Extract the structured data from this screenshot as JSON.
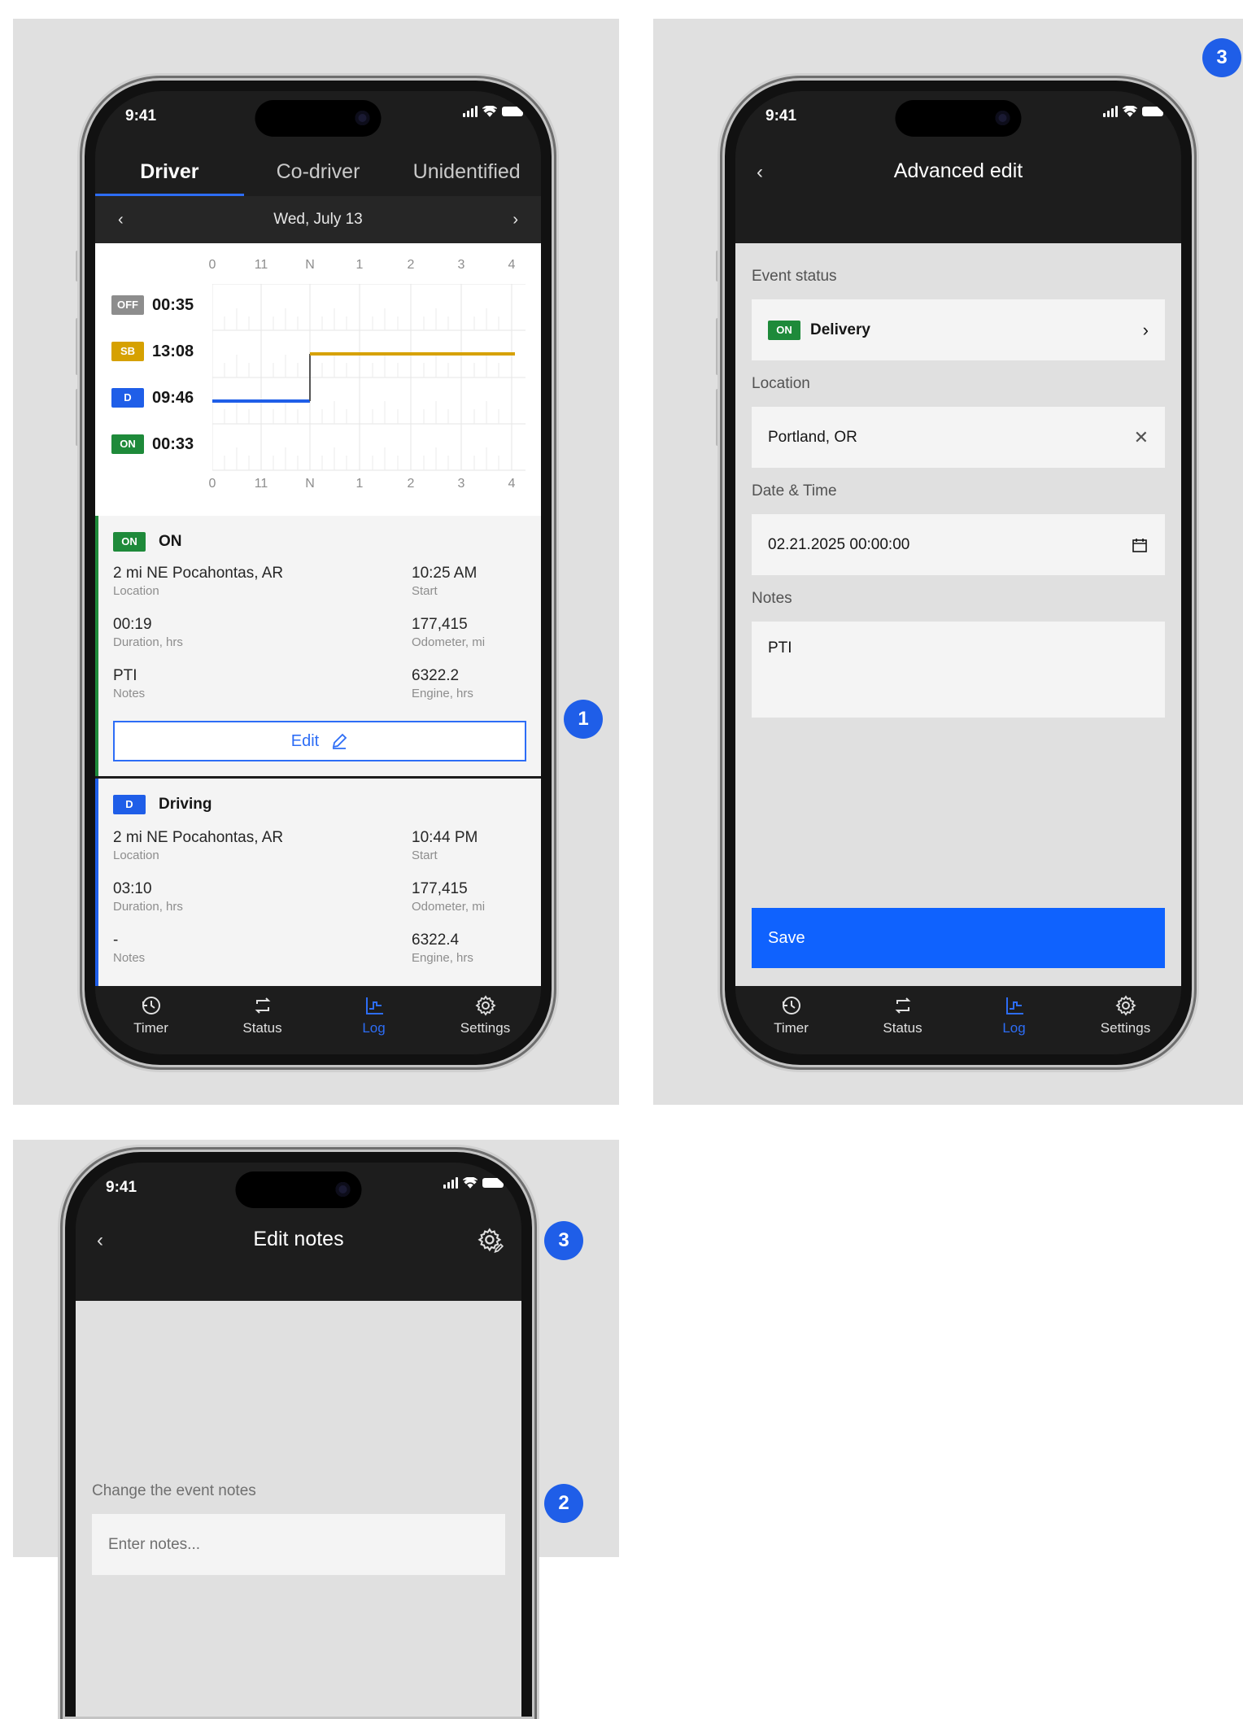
{
  "status_bar": {
    "time": "9:41"
  },
  "screen1": {
    "tabs": [
      "Driver",
      "Co-driver",
      "Unidentified"
    ],
    "date": "Wed, July 13",
    "axis_labels": [
      "0",
      "11",
      "N",
      "1",
      "2",
      "3",
      "4"
    ],
    "statuses": [
      {
        "code": "OFF",
        "time": "00:35"
      },
      {
        "code": "SB",
        "time": "13:08"
      },
      {
        "code": "D",
        "time": "09:46"
      },
      {
        "code": "ON",
        "time": "00:33"
      }
    ],
    "events": [
      {
        "badge": "ON",
        "title": "ON",
        "location": "2 mi NE Pocahontas, AR",
        "location_label": "Location",
        "start": "10:25 AM",
        "start_label": "Start",
        "duration": "00:19",
        "duration_label": "Duration, hrs",
        "odometer": "177,415",
        "odometer_label": "Odometer, mi",
        "notes": "PTI",
        "notes_label": "Notes",
        "engine": "6322.2",
        "engine_label": "Engine, hrs",
        "edit_label": "Edit"
      },
      {
        "badge": "D",
        "title": "Driving",
        "location": "2 mi NE Pocahontas, AR",
        "location_label": "Location",
        "start": "10:44 PM",
        "start_label": "Start",
        "duration": "03:10",
        "duration_label": "Duration, hrs",
        "odometer": "177,415",
        "odometer_label": "Odometer, mi",
        "notes": "-",
        "notes_label": "Notes",
        "engine": "6322.4",
        "engine_label": "Engine, hrs"
      }
    ]
  },
  "bottom_nav": [
    "Timer",
    "Status",
    "Log",
    "Settings"
  ],
  "screen2": {
    "title": "Advanced edit",
    "event_status_label": "Event status",
    "event_status_badge": "ON",
    "event_status_value": "Delivery",
    "location_label": "Location",
    "location_value": "Portland, OR",
    "datetime_label": "Date & Time",
    "datetime_value": "02.21.2025 00:00:00",
    "notes_label": "Notes",
    "notes_value": "PTI",
    "save_label": "Save"
  },
  "screen3": {
    "title": "Edit notes",
    "prompt": "Change the event notes",
    "placeholder": "Enter notes..."
  },
  "markers": [
    "1",
    "3",
    "3",
    "2"
  ],
  "colors": {
    "accent": "#0f62fe",
    "on": "#1e8a3a",
    "sb": "#d6a100",
    "driving": "#1f5ee8",
    "off": "#8d8d8d"
  }
}
